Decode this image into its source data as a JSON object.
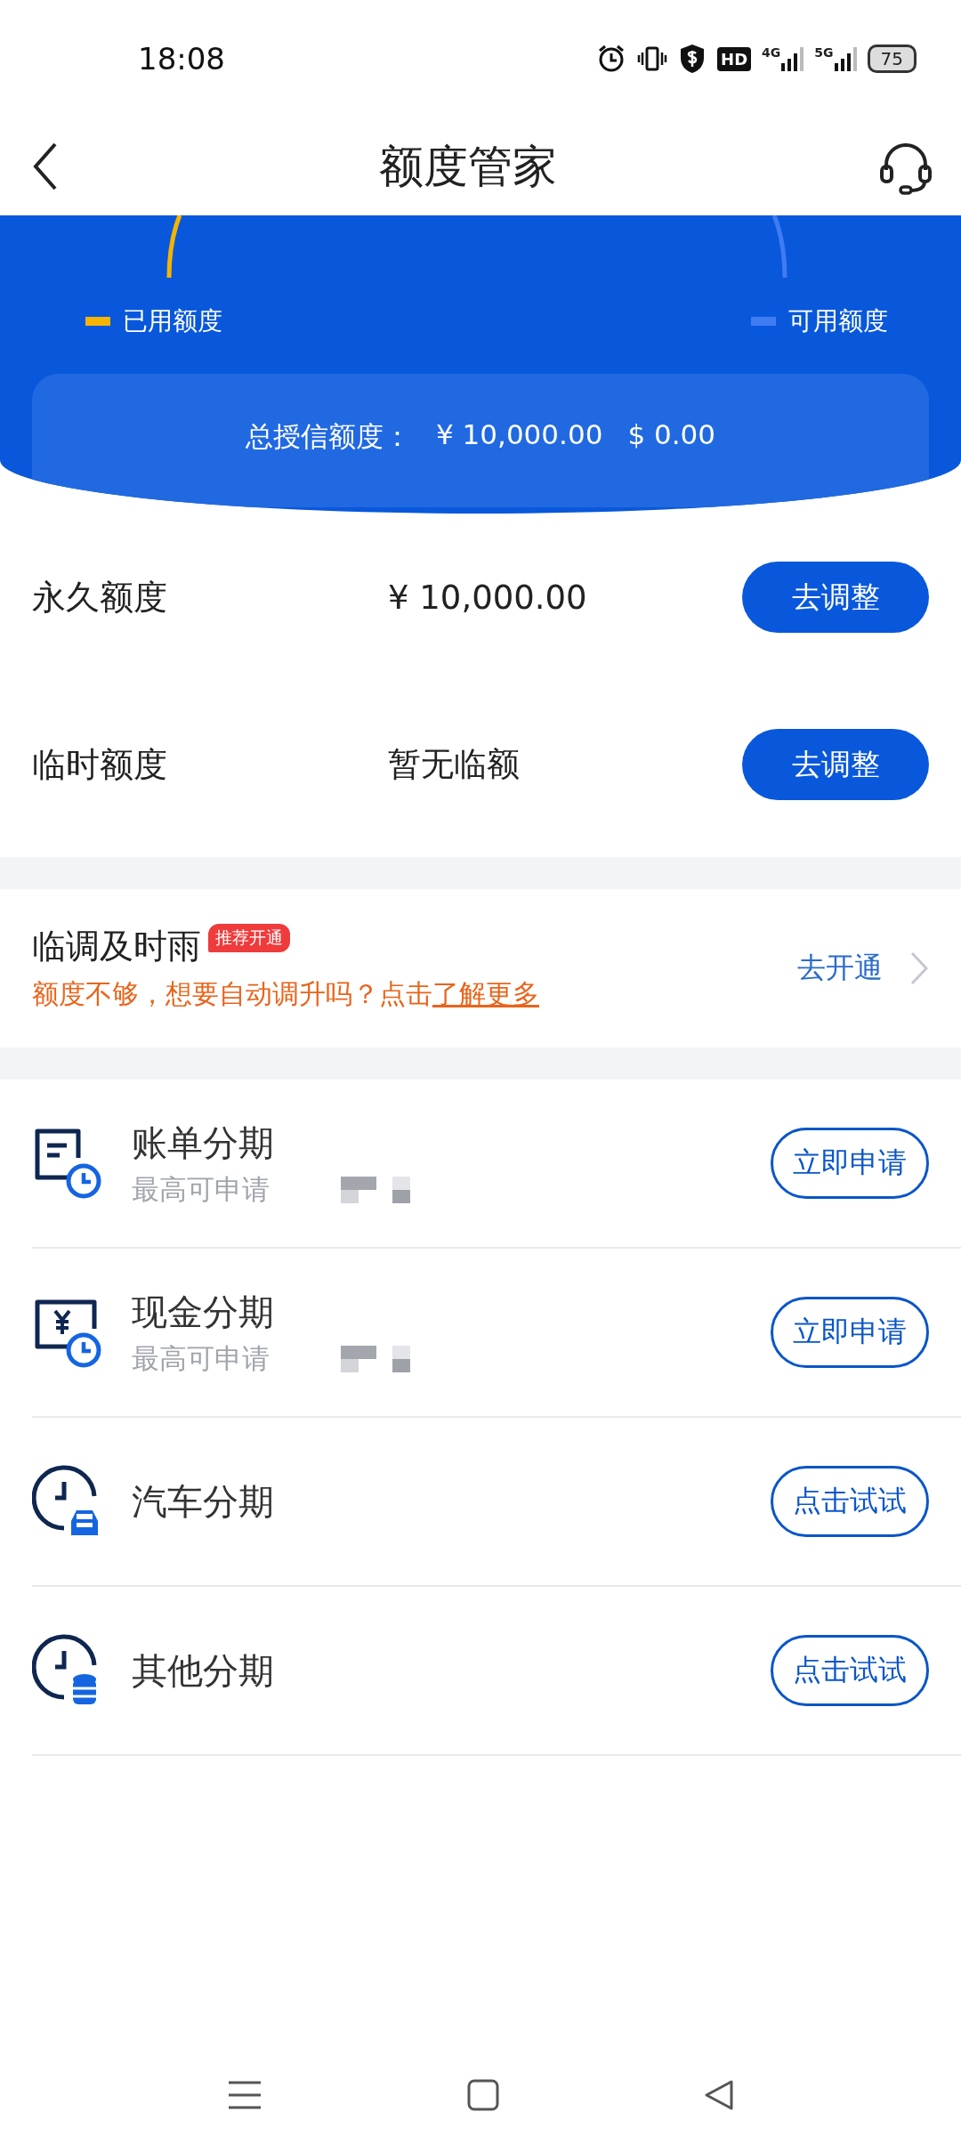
{
  "status_bar": {
    "time": "18:08",
    "hd": "HD",
    "networks": [
      "4G",
      "5G"
    ],
    "battery": "75"
  },
  "header": {
    "title": "额度管家"
  },
  "gauge": {
    "legend": [
      {
        "label": "已用额度",
        "color": "#f5b400"
      },
      {
        "label": "可用额度",
        "color": "#3f7cf2"
      }
    ],
    "total": {
      "label": "总授信额度：",
      "cny": "¥ 10,000.00",
      "usd": "$ 0.00"
    }
  },
  "limits": [
    {
      "label": "永久额度",
      "value": "¥ 10,000.00",
      "button": "去调整"
    },
    {
      "label": "临时额度",
      "value": "暂无临额",
      "button": "去调整"
    }
  ],
  "promo": {
    "title": "临调及时雨",
    "badge": "推荐开通",
    "text": "额度不够，想要自动调升吗？点击",
    "link": "了解更多",
    "action": "去开通"
  },
  "installments": [
    {
      "kind": "bill",
      "title": "账单分期",
      "subtitle": "最高可申请",
      "masked": true,
      "button": "立即申请"
    },
    {
      "kind": "cash",
      "title": "现金分期",
      "subtitle": "最高可申请",
      "masked": true,
      "button": "立即申请"
    },
    {
      "kind": "car",
      "title": "汽车分期",
      "button": "点击试试"
    },
    {
      "kind": "other",
      "title": "其他分期",
      "button": "点击试试"
    }
  ]
}
